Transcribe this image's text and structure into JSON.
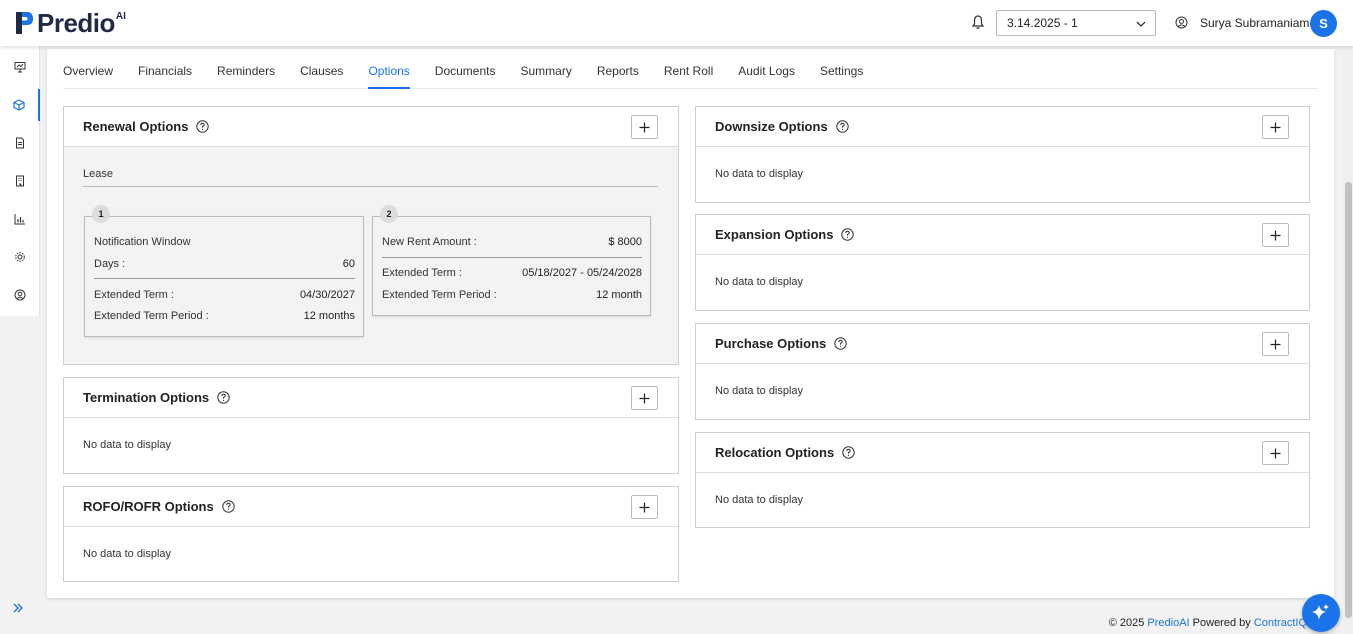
{
  "header": {
    "logo_text": "Predio",
    "logo_sup": "AI",
    "version": "3.14.2025 - 1",
    "user_name": "Surya Subramaniam",
    "avatar_initial": "S"
  },
  "sidebar": {
    "items": [
      {
        "icon": "presentation-icon"
      },
      {
        "icon": "cube-icon",
        "active": true
      },
      {
        "icon": "document-icon"
      },
      {
        "icon": "building-icon"
      },
      {
        "icon": "bar-chart-icon"
      },
      {
        "icon": "gear-icon"
      },
      {
        "icon": "user-circle-icon"
      }
    ]
  },
  "tabs": [
    "Overview",
    "Financials",
    "Reminders",
    "Clauses",
    "Options",
    "Documents",
    "Summary",
    "Reports",
    "Rent Roll",
    "Audit Logs",
    "Settings"
  ],
  "active_tab": "Options",
  "renewal": {
    "title": "Renewal Options",
    "lease_label": "Lease",
    "option1": {
      "num": "1",
      "title": "Notification Window",
      "days_label": "Days :",
      "days_value": "60",
      "term_label": "Extended Term :",
      "term_value": "04/30/2027",
      "period_label": "Extended Term Period :",
      "period_value": "12 months"
    },
    "option2": {
      "num": "2",
      "rent_label": "New Rent Amount :",
      "rent_value": "$ 8000",
      "term_label": "Extended Term :",
      "term_value": "05/18/2027 - 05/24/2028",
      "period_label": "Extended Term Period :",
      "period_value": "12 month"
    }
  },
  "panels": {
    "termination": {
      "title": "Termination Options",
      "empty": "No data to display"
    },
    "rofo": {
      "title": "ROFO/ROFR Options",
      "empty": "No data to display"
    },
    "downsize": {
      "title": "Downsize Options",
      "empty": "No data to display"
    },
    "expansion": {
      "title": "Expansion Options",
      "empty": "No data to display"
    },
    "purchase": {
      "title": "Purchase Options",
      "empty": "No data to display"
    },
    "relocation": {
      "title": "Relocation Options",
      "empty": "No data to display"
    }
  },
  "footer": {
    "copyright": "© 2025 ",
    "brand": "PredioAI",
    "powered": " Powered by ",
    "company": "ContractIQ"
  },
  "colors": {
    "accent": "#1a73e8"
  }
}
